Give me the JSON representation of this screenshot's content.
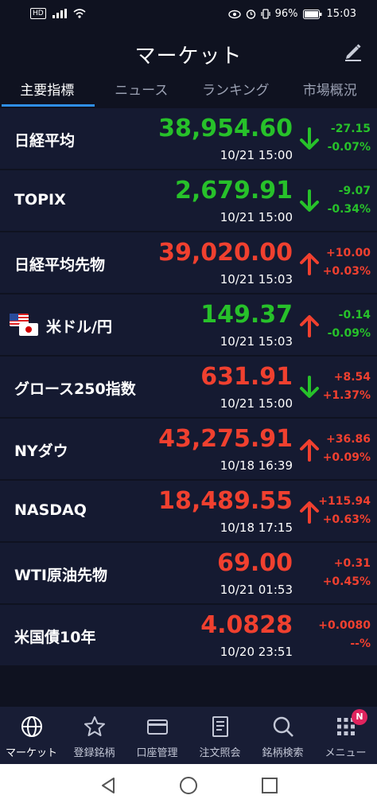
{
  "status": {
    "hd": "HD",
    "battery": "96%",
    "time": "15:03"
  },
  "header": {
    "title": "マーケット"
  },
  "tabs": [
    "主要指標",
    "ニュース",
    "ランキング",
    "市場概況"
  ],
  "markets": [
    {
      "name": "日経平均",
      "price": "38,954.60",
      "time": "10/21 15:00",
      "change": "-27.15",
      "pct": "-0.07%",
      "price_color": "green",
      "change_color": "green",
      "direction": "down",
      "flag": false
    },
    {
      "name": "TOPIX",
      "price": "2,679.91",
      "time": "10/21 15:00",
      "change": "-9.07",
      "pct": "-0.34%",
      "price_color": "green",
      "change_color": "green",
      "direction": "down",
      "flag": false
    },
    {
      "name": "日経平均先物",
      "price": "39,020.00",
      "time": "10/21 15:03",
      "change": "+10.00",
      "pct": "+0.03%",
      "price_color": "red",
      "change_color": "red",
      "direction": "up",
      "flag": false
    },
    {
      "name": "米ドル/円",
      "price": "149.37",
      "time": "10/21 15:03",
      "change": "-0.14",
      "pct": "-0.09%",
      "price_color": "green",
      "change_color": "green",
      "direction": "up",
      "flag": true
    },
    {
      "name": "グロース250指数",
      "price": "631.91",
      "time": "10/21 15:00",
      "change": "+8.54",
      "pct": "+1.37%",
      "price_color": "red",
      "change_color": "red",
      "direction": "down",
      "flag": false
    },
    {
      "name": "NYダウ",
      "price": "43,275.91",
      "time": "10/18 16:39",
      "change": "+36.86",
      "pct": "+0.09%",
      "price_color": "red",
      "change_color": "red",
      "direction": "up",
      "flag": false
    },
    {
      "name": "NASDAQ",
      "price": "18,489.55",
      "time": "10/18 17:15",
      "change": "+115.94",
      "pct": "+0.63%",
      "price_color": "red",
      "change_color": "red",
      "direction": "up",
      "flag": false
    },
    {
      "name": "WTI原油先物",
      "price": "69.00",
      "time": "10/21 01:53",
      "change": "+0.31",
      "pct": "+0.45%",
      "price_color": "red",
      "change_color": "red",
      "direction": "none",
      "flag": false
    },
    {
      "name": "米国債10年",
      "price": "4.0828",
      "time": "10/20 23:51",
      "change": "+0.0080",
      "pct": "--%",
      "price_color": "red",
      "change_color": "red",
      "direction": "none",
      "flag": false
    }
  ],
  "nav": [
    {
      "label": "マーケット",
      "icon": "globe-icon"
    },
    {
      "label": "登録銘柄",
      "icon": "star-icon"
    },
    {
      "label": "口座管理",
      "icon": "card-icon"
    },
    {
      "label": "注文照会",
      "icon": "document-icon"
    },
    {
      "label": "銘柄検索",
      "icon": "search-icon"
    },
    {
      "label": "メニュー",
      "icon": "grid-menu-icon"
    }
  ],
  "menu_badge": "N",
  "colors": {
    "up": "#f0402f",
    "down": "#27c12a",
    "accent": "#2f8ee6",
    "background": "#0f1220",
    "row": "#151a31"
  }
}
